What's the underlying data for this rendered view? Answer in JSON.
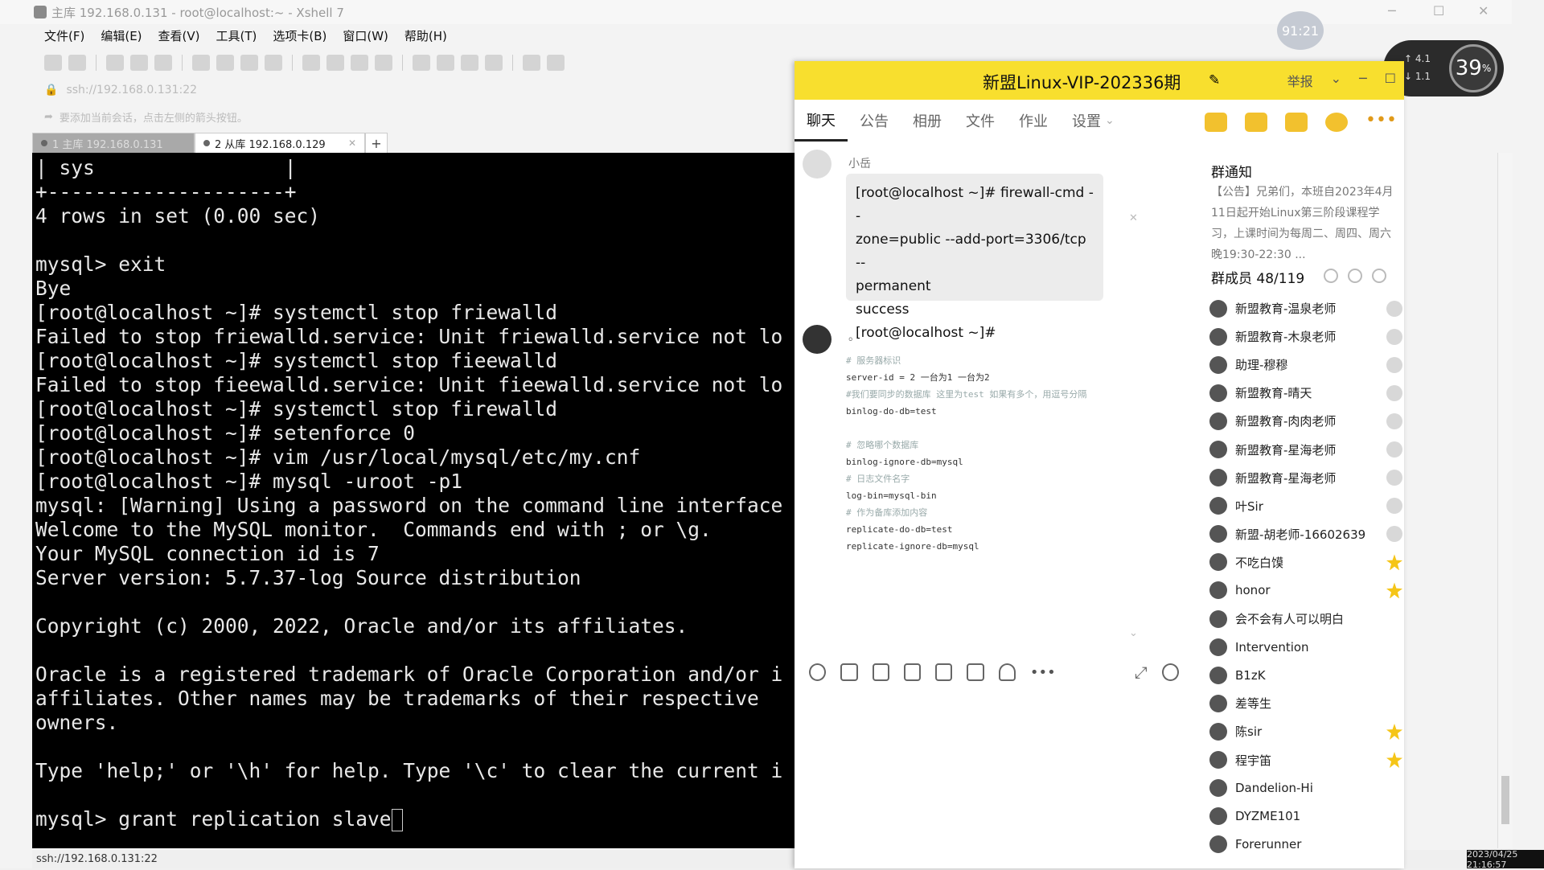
{
  "xshell": {
    "title": "主库 192.168.0.131 - root@localhost:~ - Xshell 7",
    "menu": [
      "文件(F)",
      "编辑(E)",
      "查看(V)",
      "工具(T)",
      "选项卡(B)",
      "窗口(W)",
      "帮助(H)"
    ],
    "address": "ssh://192.168.0.131:22",
    "hint": "要添加当前会话，点击左侧的箭头按钮。",
    "tabs": [
      {
        "label": "1 主库 192.168.0.131"
      },
      {
        "label": "2 从库 192.168.0.129"
      }
    ],
    "add_tab": "+",
    "terminal_text": "| sys                |\n+--------------------+\n4 rows in set (0.00 sec)\n\nmysql> exit\nBye\n[root@localhost ~]# systemctl stop friewalld\nFailed to stop friewalld.service: Unit friewalld.service not lo\n[root@localhost ~]# systemctl stop fieewalld\nFailed to stop fieewalld.service: Unit fieewalld.service not lo\n[root@localhost ~]# systemctl stop firewalld\n[root@localhost ~]# setenforce 0\n[root@localhost ~]# vim /usr/local/mysql/etc/my.cnf\n[root@localhost ~]# mysql -uroot -p1\nmysql: [Warning] Using a password on the command line interface\nWelcome to the MySQL monitor.  Commands end with ; or \\g.\nYour MySQL connection id is 7\nServer version: 5.7.37-log Source distribution\n\nCopyright (c) 2000, 2022, Oracle and/or its affiliates.\n\nOracle is a registered trademark of Oracle Corporation and/or i\naffiliates. Other names may be trademarks of their respective\nowners.\n\nType 'help;' or '\\h' for help. Type '\\c' to clear the current i\n\nmysql> grant replication slave",
    "status": "ssh://192.168.0.131:22",
    "clock": "2023/04/25 21:16:57"
  },
  "overlay": {
    "timer": "91:21",
    "up": "4.1",
    "down": "1.1",
    "percent": "39",
    "percent_unit": "%"
  },
  "qq": {
    "group_name": "新盟Linux-VIP-202336期",
    "report": "举报",
    "tabs": [
      "聊天",
      "公告",
      "相册",
      "文件",
      "作业",
      "设置"
    ],
    "message1": {
      "sender": "小岳",
      "lines": [
        "[root@localhost ~]#  firewall-cmd --",
        "zone=public --add-port=3306/tcp --",
        "permanent",
        "success",
        "[root@localhost ~]#"
      ]
    },
    "message2": {
      "sender": "。",
      "code": [
        {
          "t": "# 服务器标识",
          "c": true
        },
        {
          "t": "server-id = 2    一台为1 一台为2",
          "c": false
        },
        {
          "t": "#我们要同步的数据库  这里为test 如果有多个，用逗号分隔",
          "c": true
        },
        {
          "t": "binlog-do-db=test",
          "c": false
        },
        {
          "t": "",
          "c": false
        },
        {
          "t": "# 忽略哪个数据库",
          "c": true
        },
        {
          "t": "binlog-ignore-db=mysql",
          "c": false
        },
        {
          "t": "# 日志文件名字",
          "c": true
        },
        {
          "t": "log-bin=mysql-bin",
          "c": false
        },
        {
          "t": "# 作为备库添加内容",
          "c": true
        },
        {
          "t": "replicate-do-db=test",
          "c": false
        },
        {
          "t": "replicate-ignore-db=mysql",
          "c": false
        }
      ]
    },
    "notice_title": "群通知",
    "notice_text": "【公告】兄弟们，本班自2023年4月11日起开始Linux第三阶段课程学习，上课时间为每周二、周四、周六晚19:30-22:30 ...",
    "members_title": "群成员 48/119",
    "members": [
      {
        "name": "新盟教育-温泉老师",
        "badge": "admin"
      },
      {
        "name": "新盟教育-木泉老师",
        "badge": "admin"
      },
      {
        "name": "助理-穆穆",
        "badge": "admin"
      },
      {
        "name": "新盟教育-晴天",
        "badge": "admin"
      },
      {
        "name": "新盟教育-肉肉老师",
        "badge": "admin"
      },
      {
        "name": "新盟教育-星海老师",
        "badge": "admin"
      },
      {
        "name": "新盟教育-星海老师",
        "badge": "admin"
      },
      {
        "name": "叶Sir",
        "badge": "admin"
      },
      {
        "name": "新盟-胡老师-16602639",
        "badge": "admin"
      },
      {
        "name": "不吃白馍",
        "badge": "star"
      },
      {
        "name": "honor",
        "badge": "star"
      },
      {
        "name": "会不会有人可以明白",
        "badge": "none"
      },
      {
        "name": "Intervention",
        "badge": "none"
      },
      {
        "name": "B1zK",
        "badge": "none"
      },
      {
        "name": "差等生",
        "badge": "none"
      },
      {
        "name": "陈sir",
        "badge": "star"
      },
      {
        "name": "程宇笛",
        "badge": "star"
      },
      {
        "name": "Dandelion-Hi",
        "badge": "none"
      },
      {
        "name": "DYZME101",
        "badge": "none"
      },
      {
        "name": "Forerunner",
        "badge": "none"
      }
    ]
  }
}
